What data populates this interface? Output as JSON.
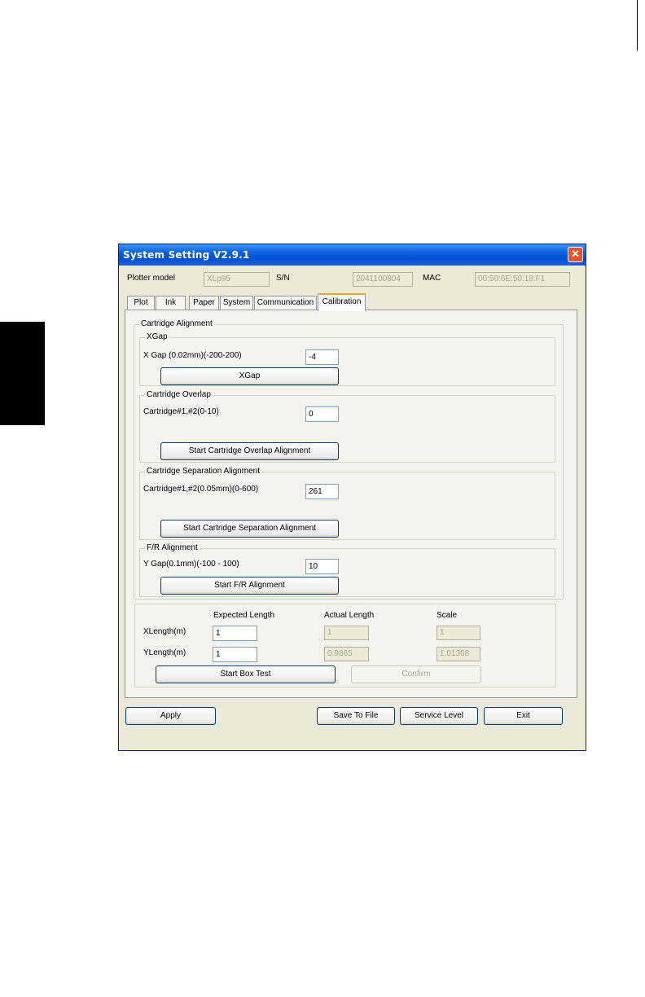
{
  "window": {
    "title": "System Setting V2.9.1",
    "close_glyph": "✕"
  },
  "device": {
    "model_label": "Plotter model",
    "model_value": "XLp95",
    "sn_label": "S/N",
    "sn_value": "2041100804",
    "mac_label": "MAC",
    "mac_value": "00:50:6E:50:18:F1"
  },
  "tabs": [
    {
      "label": "Plot"
    },
    {
      "label": "Ink"
    },
    {
      "label": "Paper"
    },
    {
      "label": "System"
    },
    {
      "label": "Communication"
    },
    {
      "label": "Calibration"
    }
  ],
  "active_tab": "Calibration",
  "calibration": {
    "alignment_title": "Cartridge Alignment",
    "xgap": {
      "title": "XGap",
      "label": "X Gap (0.02mm)(-200-200)",
      "value": "-4",
      "button": "XGap"
    },
    "overlap": {
      "title": "Cartridge Overlap",
      "label": "Cartridge#1,#2(0-10)",
      "value": "0",
      "button": "Start Cartridge Overlap Alignment"
    },
    "separation": {
      "title": "Cartridge Separation Alignment",
      "label": "Cartridge#1,#2(0.05mm)(0-600)",
      "value": "261",
      "button": "Start Cartridge Separation Alignment"
    },
    "fr": {
      "title": "F/R Alignment",
      "label": "Y Gap(0.1mm)(-100 - 100)",
      "value": "10",
      "button": "Start F/R Alignment"
    },
    "box_test": {
      "col_expected": "Expected Length",
      "col_actual": "Actual Length",
      "col_scale": "Scale",
      "x_label": "XLength(m)",
      "x_expected": "1",
      "x_actual": "1",
      "x_scale": "1",
      "y_label": "YLength(m)",
      "y_expected": "1",
      "y_actual": "0.9865",
      "y_scale": "1.01368",
      "start_button": "Start Box Test",
      "confirm_button": "Confirm"
    }
  },
  "footer": {
    "apply": "Apply",
    "save": "Save To File",
    "service": "Service Level",
    "exit": "Exit"
  },
  "colors": {
    "titlebar": "#0a5fd8",
    "dialog_bg": "#ece9d8",
    "active_tab_accent": "#f3a32b",
    "close_button": "#e2562f"
  }
}
